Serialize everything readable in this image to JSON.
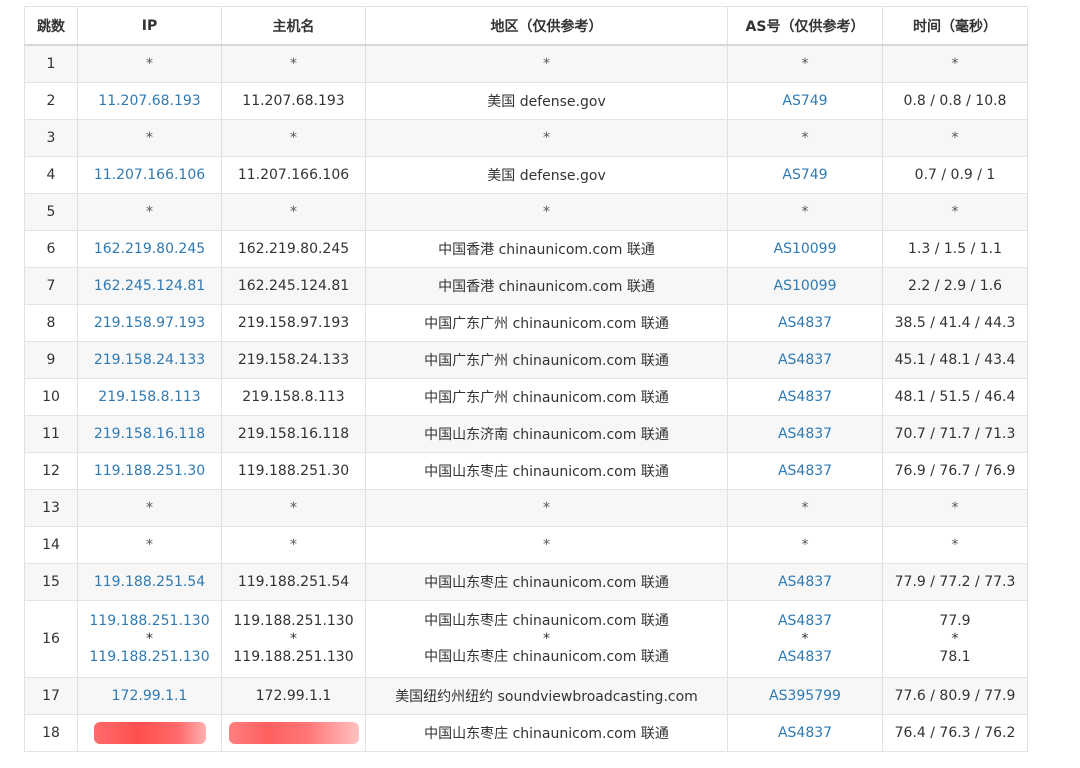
{
  "headers": [
    "跳数",
    "IP",
    "主机名",
    "地区（仅供参考）",
    "AS号（仅供参考）",
    "时间（毫秒）"
  ],
  "rows": [
    {
      "hop": "1",
      "ip": "*",
      "host": "*",
      "region": "*",
      "as": "*",
      "time": "*"
    },
    {
      "hop": "2",
      "ip": "11.207.68.193",
      "host": "11.207.68.193",
      "region": "美国 defense.gov",
      "as": "AS749",
      "time": "0.8 / 0.8 / 10.8"
    },
    {
      "hop": "3",
      "ip": "*",
      "host": "*",
      "region": "*",
      "as": "*",
      "time": "*"
    },
    {
      "hop": "4",
      "ip": "11.207.166.106",
      "host": "11.207.166.106",
      "region": "美国 defense.gov",
      "as": "AS749",
      "time": "0.7 / 0.9 / 1"
    },
    {
      "hop": "5",
      "ip": "*",
      "host": "*",
      "region": "*",
      "as": "*",
      "time": "*"
    },
    {
      "hop": "6",
      "ip": "162.219.80.245",
      "host": "162.219.80.245",
      "region": "中国香港 chinaunicom.com 联通",
      "as": "AS10099",
      "time": "1.3 / 1.5 / 1.1"
    },
    {
      "hop": "7",
      "ip": "162.245.124.81",
      "host": "162.245.124.81",
      "region": "中国香港 chinaunicom.com 联通",
      "as": "AS10099",
      "time": "2.2 / 2.9 / 1.6"
    },
    {
      "hop": "8",
      "ip": "219.158.97.193",
      "host": "219.158.97.193",
      "region": "中国广东广州 chinaunicom.com 联通",
      "as": "AS4837",
      "time": "38.5 / 41.4 / 44.3"
    },
    {
      "hop": "9",
      "ip": "219.158.24.133",
      "host": "219.158.24.133",
      "region": "中国广东广州 chinaunicom.com 联通",
      "as": "AS4837",
      "time": "45.1 / 48.1 / 43.4"
    },
    {
      "hop": "10",
      "ip": "219.158.8.113",
      "host": "219.158.8.113",
      "region": "中国广东广州 chinaunicom.com 联通",
      "as": "AS4837",
      "time": "48.1 / 51.5 / 46.4"
    },
    {
      "hop": "11",
      "ip": "219.158.16.118",
      "host": "219.158.16.118",
      "region": "中国山东济南 chinaunicom.com 联通",
      "as": "AS4837",
      "time": "70.7 / 71.7 / 71.3"
    },
    {
      "hop": "12",
      "ip": "119.188.251.30",
      "host": "119.188.251.30",
      "region": "中国山东枣庄 chinaunicom.com 联通",
      "as": "AS4837",
      "time": "76.9 / 76.7 / 76.9"
    },
    {
      "hop": "13",
      "ip": "*",
      "host": "*",
      "region": "*",
      "as": "*",
      "time": "*"
    },
    {
      "hop": "14",
      "ip": "*",
      "host": "*",
      "region": "*",
      "as": "*",
      "time": "*"
    },
    {
      "hop": "15",
      "ip": "119.188.251.54",
      "host": "119.188.251.54",
      "region": "中国山东枣庄 chinaunicom.com 联通",
      "as": "AS4837",
      "time": "77.9 / 77.2 / 77.3"
    }
  ],
  "row16": {
    "hop": "16",
    "ip": [
      "119.188.251.130",
      "*",
      "119.188.251.130"
    ],
    "host": [
      "119.188.251.130",
      "*",
      "119.188.251.130"
    ],
    "region": [
      "中国山东枣庄 chinaunicom.com 联通",
      "*",
      "中国山东枣庄 chinaunicom.com 联通"
    ],
    "as": [
      "AS4837",
      "*",
      "AS4837"
    ],
    "time": [
      "77.9",
      "*",
      "78.1"
    ]
  },
  "row17": {
    "hop": "17",
    "ip": "172.99.1.1",
    "host": "172.99.1.1",
    "region": "美国纽约州纽约 soundviewbroadcasting.com",
    "as": "AS395799",
    "time": "77.6 / 80.9 / 77.9"
  },
  "row18": {
    "hop": "18",
    "region": "中国山东枣庄 chinaunicom.com 联通",
    "as": "AS4837",
    "time": "76.4 / 76.3 / 76.2"
  },
  "colors": {
    "link": "#2f7ab3",
    "stripe": "#f7f7f7",
    "border": "#e2e2e2",
    "redaction": "#ff5a5a"
  }
}
